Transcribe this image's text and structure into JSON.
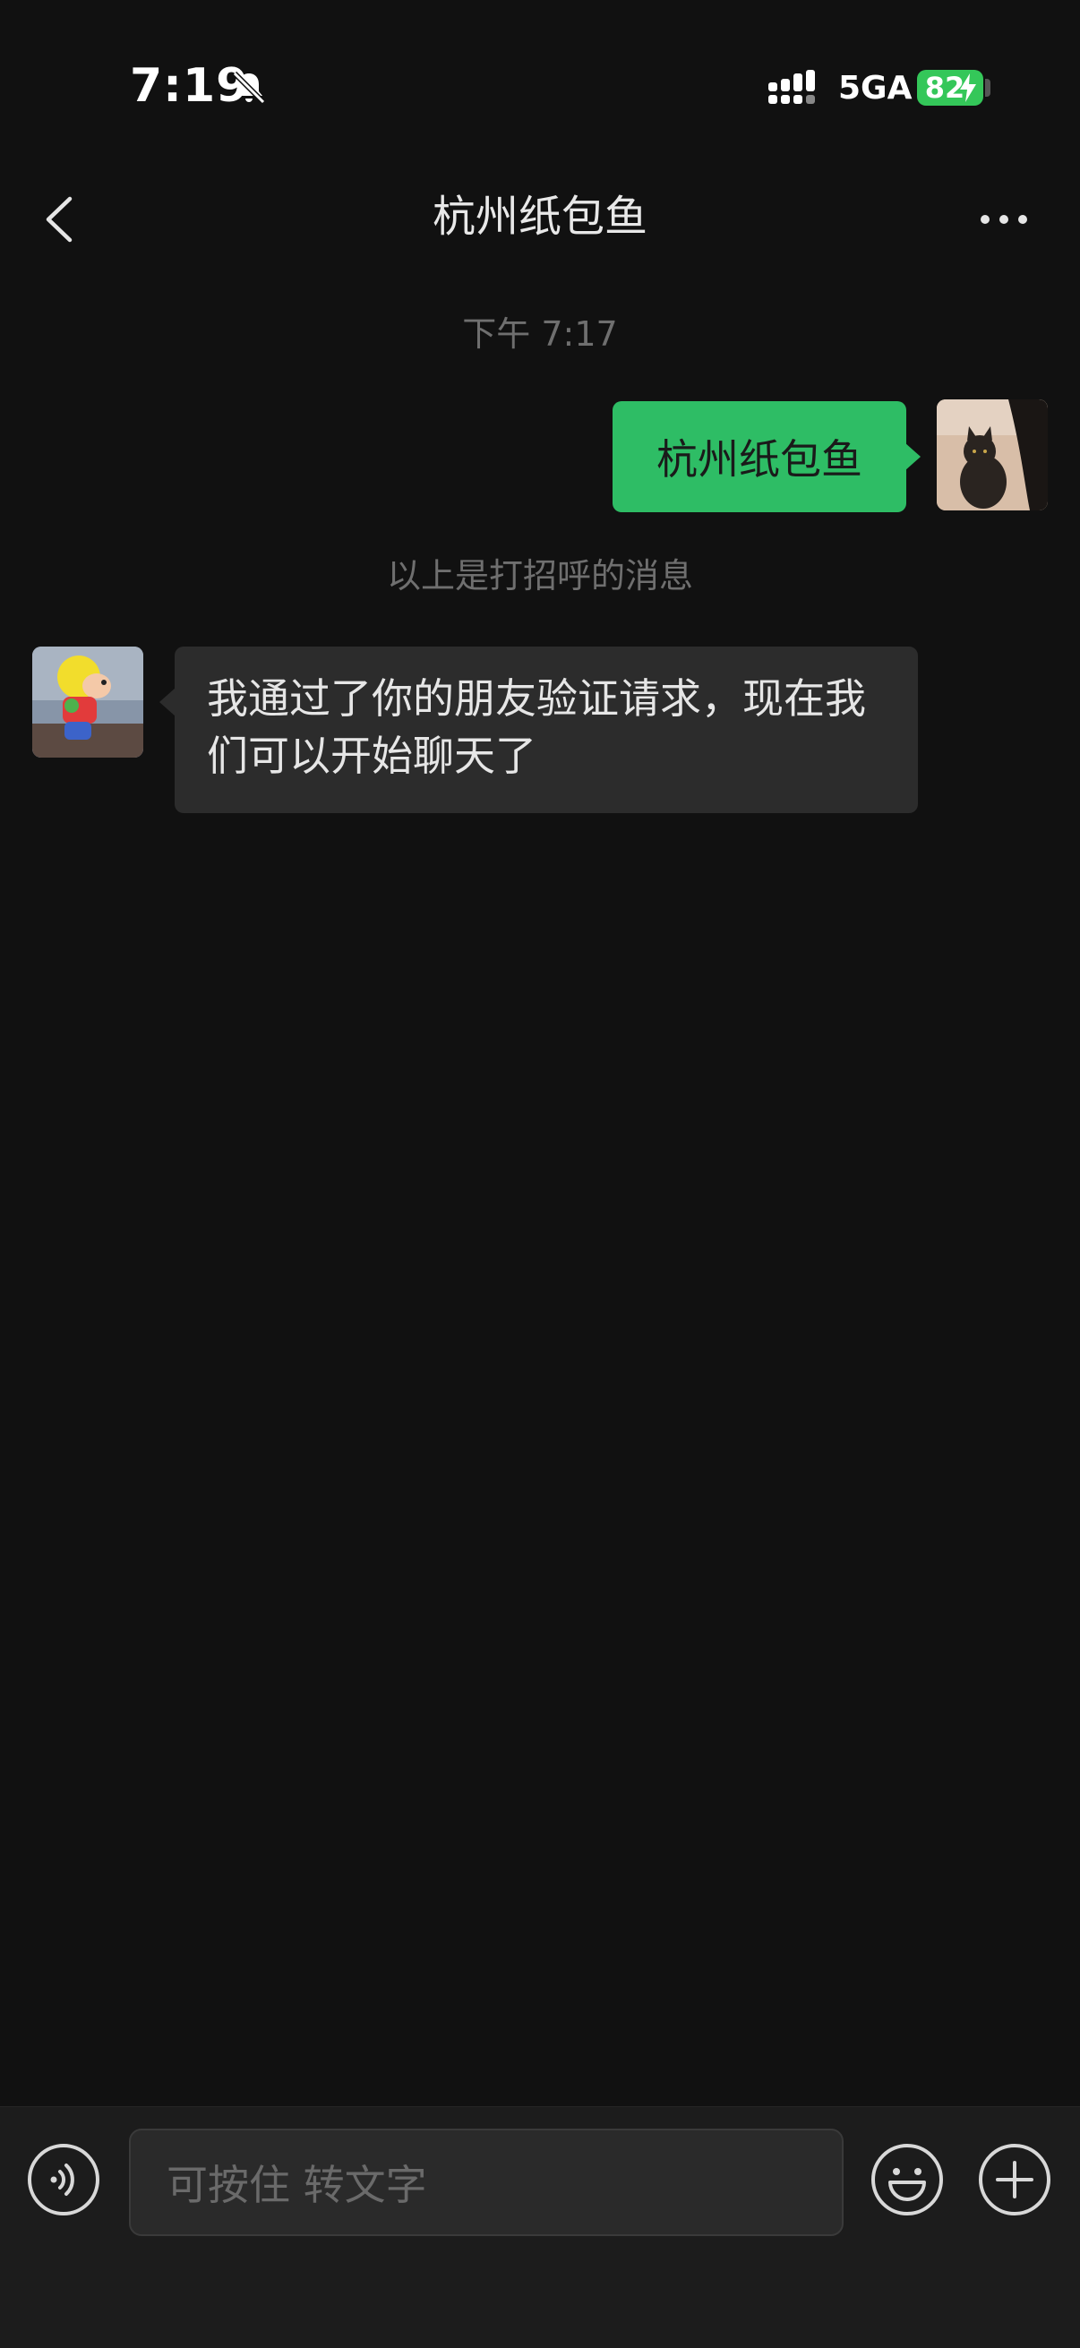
{
  "status_bar": {
    "time": "7:19",
    "network": "5GA",
    "battery": "82",
    "battery_color": "#34c759"
  },
  "nav": {
    "title": "杭州纸包鱼",
    "back_icon": "chevron-left-icon",
    "more_icon": "ellipsis-icon"
  },
  "chat": {
    "timestamp": "下午 7:17",
    "messages": [
      {
        "sender": "me",
        "text": "杭州纸包鱼",
        "bubble_color": "#2ebd65"
      },
      {
        "sender": "friend",
        "text": "我通过了你的朋友验证请求，现在我们可以开始聊天了",
        "bubble_color": "#2c2c2c"
      }
    ],
    "greeting_note": "以上是打招呼的消息"
  },
  "input_bar": {
    "placeholder": "可按住 转文字",
    "voice_icon": "voice-icon",
    "emoji_icon": "emoji-icon",
    "plus_icon": "plus-icon"
  }
}
